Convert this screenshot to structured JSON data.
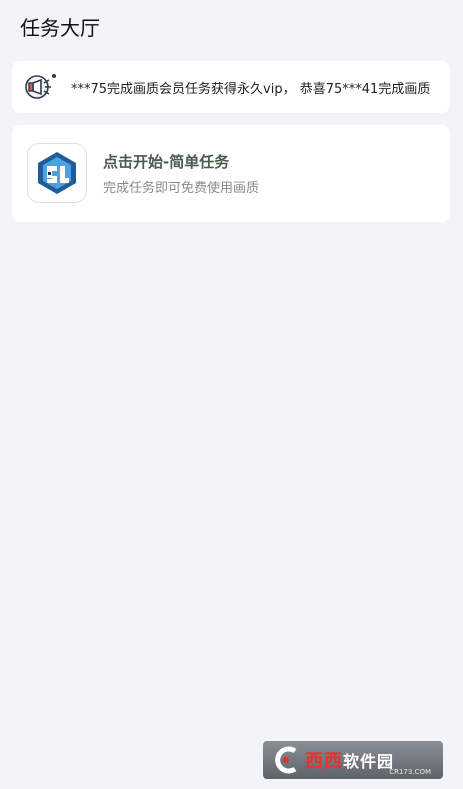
{
  "header": {
    "title": "任务大厅"
  },
  "notice": {
    "icon": "megaphone-icon",
    "text": "***75完成画质会员任务获得永久vip， 恭喜75***41完成画质"
  },
  "task": {
    "icon": "app-logo-icon",
    "title": "点击开始-简单任务",
    "subtitle": "完成任务即可免费使用画质"
  },
  "watermark": {
    "text_part1": "西西",
    "text_part2": "软件园",
    "sub": "CR173.COM"
  }
}
